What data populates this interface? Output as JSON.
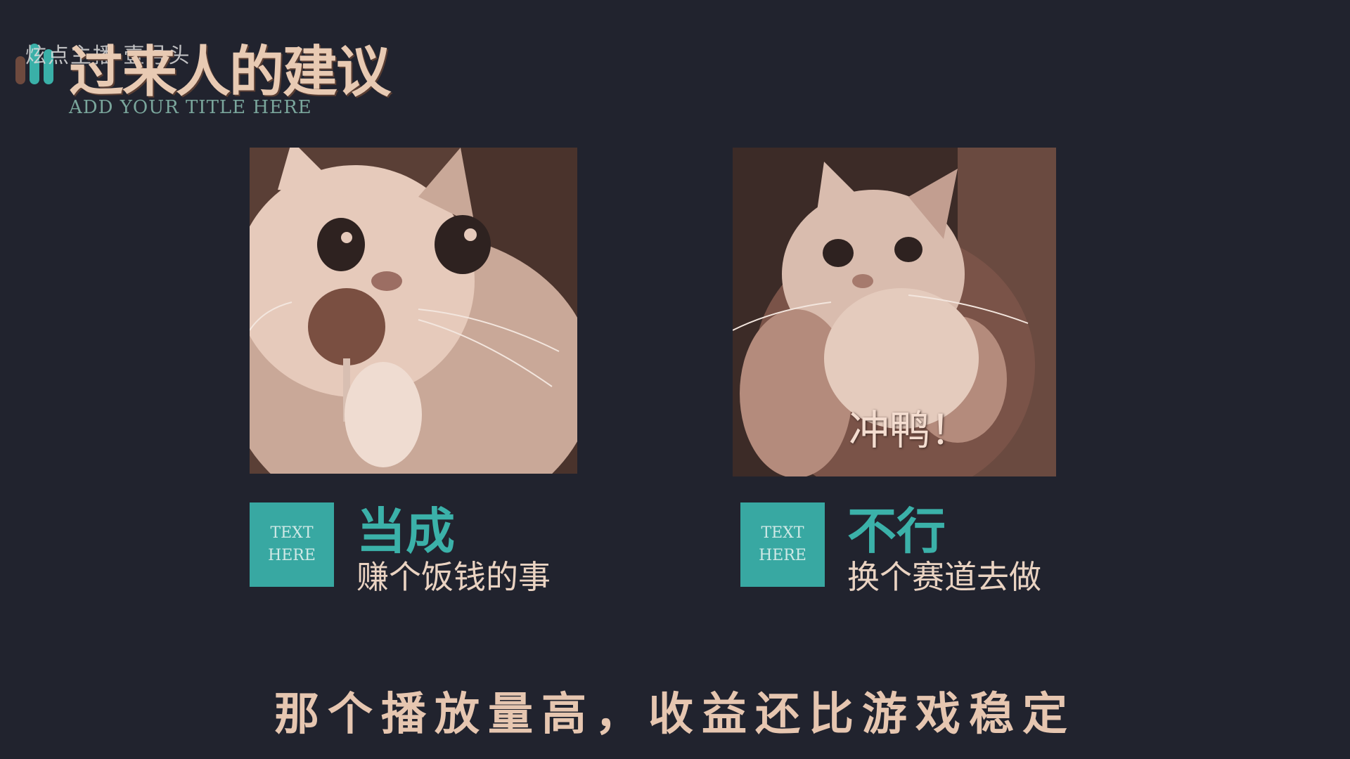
{
  "watermark": "炫点主播 壹号头",
  "slide": {
    "title": "过来人的建议",
    "subtitle": "ADD YOUR TITLE HERE"
  },
  "cards": [
    {
      "badge_line1": "TEXT",
      "badge_line2": "HERE",
      "heading": "当成",
      "text": "赚个饭钱的事"
    },
    {
      "badge_line1": "TEXT",
      "badge_line2": "HERE",
      "heading": "不行",
      "text": "换个赛道去做",
      "image_caption": "冲鸭！"
    }
  ],
  "video_subtitle": "那个播放量高，收益还比游戏稳定",
  "colors": {
    "background": "#21232e",
    "accent_teal": "#38a8a2",
    "warm_text": "#e8cab3"
  }
}
